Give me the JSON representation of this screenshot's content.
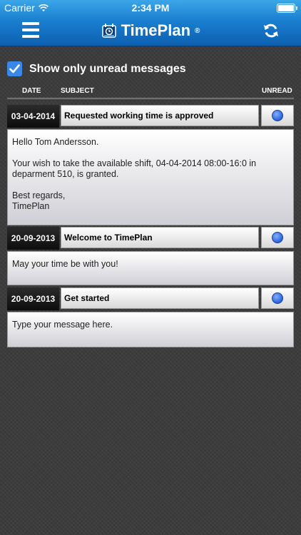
{
  "status_bar": {
    "carrier": "Carrier",
    "time": "2:34 PM"
  },
  "app": {
    "title": "TimePlan",
    "trademark": "®"
  },
  "filter": {
    "label": "Show only unread messages",
    "checked": true
  },
  "columns": {
    "date": "DATE",
    "subject": "SUBJECT",
    "unread": "UNREAD"
  },
  "messages": [
    {
      "date": "03-04-2014",
      "subject": "Requested working time is approved",
      "unread": true,
      "body": [
        "Hello Tom Andersson.",
        "Your wish to take the available shift, 04-04-2014  08:00-16:0 in deparment 510, is granted.",
        "Best regards,\nTimePlan"
      ]
    },
    {
      "date": "20-09-2013",
      "subject": "Welcome to TimePlan",
      "unread": true,
      "body": [
        "May your time be with you!"
      ]
    },
    {
      "date": "20-09-2013",
      "subject": "Get started",
      "unread": true,
      "body": [
        "Type your message here."
      ]
    }
  ],
  "colors": {
    "nav_top": "#3ba6e8",
    "nav_bottom": "#0d5fb0",
    "unread_dot": "#2d62d8",
    "checkbox": "#3b87e8"
  }
}
